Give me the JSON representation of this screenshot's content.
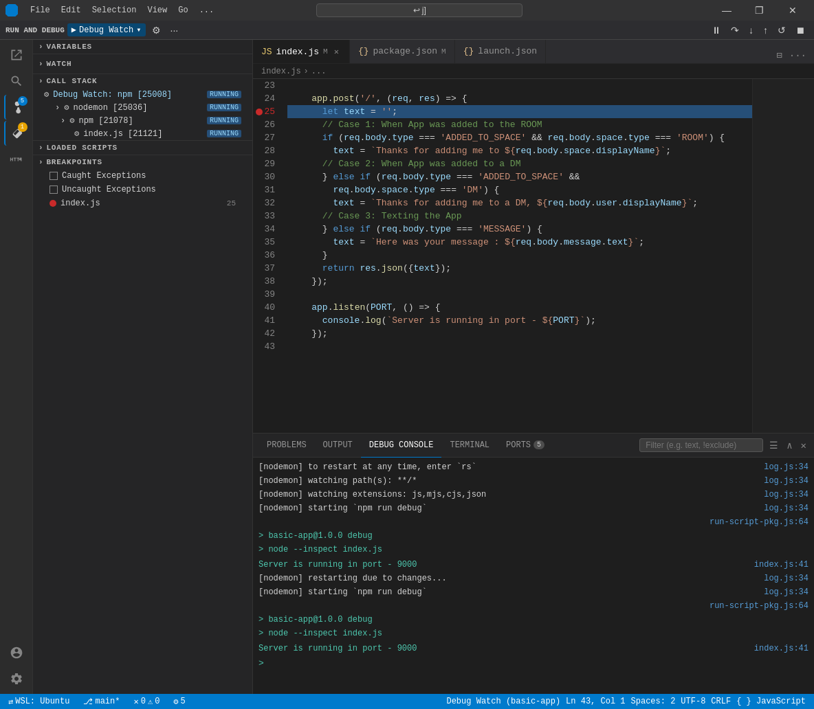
{
  "titlebar": {
    "menu_items": [
      "File",
      "Edit",
      "Selection",
      "View",
      "Go",
      "..."
    ],
    "search_placeholder": "",
    "controls": [
      "—",
      "❐",
      "✕"
    ]
  },
  "debug_toolbar": {
    "label": "RUN AND DEBUG",
    "dropdown_label": "Debug Watch",
    "buttons": [
      "▶",
      "⏸",
      "↻",
      "↓",
      "↑",
      "↺",
      "⏹"
    ]
  },
  "tabs": [
    {
      "label": "index.js",
      "modified": true,
      "active": true,
      "icon": "JS"
    },
    {
      "label": "package.json",
      "modified": true,
      "active": false,
      "icon": "{}"
    },
    {
      "label": "launch.json",
      "modified": false,
      "active": false,
      "icon": "{}"
    }
  ],
  "breadcrumb": "index.js > ...",
  "code_lines": [
    {
      "num": 23,
      "content": ""
    },
    {
      "num": 24,
      "content": "    app.post('/', (req, res) => {",
      "tokens": [
        {
          "t": "fn",
          "v": "app.post"
        },
        {
          "t": "punct",
          "v": "("
        },
        {
          "t": "str",
          "v": "'/'"
        },
        {
          "t": "punct",
          "v": ", ("
        },
        {
          "t": "param",
          "v": "req"
        },
        {
          "t": "punct",
          "v": ", "
        },
        {
          "t": "param",
          "v": "res"
        },
        {
          "t": "punct",
          "v": ") => {"
        }
      ]
    },
    {
      "num": 25,
      "content": "      let text = '';",
      "breakpoint": true
    },
    {
      "num": 26,
      "content": "      // Case 1: When App was added to the ROOM",
      "comment": true
    },
    {
      "num": 27,
      "content": "      if (req.body.type === 'ADDED_TO_SPACE' && req.body.space.type === 'ROOM') {"
    },
    {
      "num": 28,
      "content": "        text = `Thanks for adding me to ${req.body.space.displayName}`;"
    },
    {
      "num": 29,
      "content": "      // Case 2: When App was added to a DM",
      "comment": true
    },
    {
      "num": 30,
      "content": "      } else if (req.body.type === 'ADDED_TO_SPACE' &&"
    },
    {
      "num": 31,
      "content": "        req.body.space.type === 'DM') {"
    },
    {
      "num": 32,
      "content": "        text = `Thanks for adding me to a DM, ${req.body.user.displayName}`;"
    },
    {
      "num": 33,
      "content": "      // Case 3: Texting the App",
      "comment": true
    },
    {
      "num": 34,
      "content": "      } else if (req.body.type === 'MESSAGE') {"
    },
    {
      "num": 35,
      "content": "        text = `Here was your message : ${req.body.message.text}`;"
    },
    {
      "num": 36,
      "content": "      }"
    },
    {
      "num": 37,
      "content": "      return res.json({text});"
    },
    {
      "num": 38,
      "content": "    });"
    },
    {
      "num": 39,
      "content": ""
    },
    {
      "num": 40,
      "content": "    app.listen(PORT, () => {"
    },
    {
      "num": 41,
      "content": "      console.log(`Server is running in port - ${PORT}`);"
    },
    {
      "num": 42,
      "content": "    });"
    },
    {
      "num": 43,
      "content": ""
    }
  ],
  "sidebar": {
    "sections": {
      "variables": "VARIABLES",
      "watch": "WATCH",
      "call_stack": "CALL STACK",
      "loaded_scripts": "LOADED SCRIPTS",
      "breakpoints": "BREAKPOINTS"
    },
    "call_stack_items": [
      {
        "label": "Debug Watch: npm [25008]",
        "status": "RUNNING",
        "indent": 0,
        "icon": "gear"
      },
      {
        "label": "nodemon [25036]",
        "status": "RUNNING",
        "indent": 1,
        "icon": "gear"
      },
      {
        "label": "npm [21078]",
        "status": "RUNNING",
        "indent": 2,
        "icon": "gear"
      },
      {
        "label": "index.js [21121]",
        "status": "RUNNING",
        "indent": 3,
        "icon": "gear"
      }
    ],
    "breakpoints": [
      {
        "label": "Caught Exceptions",
        "type": "checkbox",
        "checked": false
      },
      {
        "label": "Uncaught Exceptions",
        "type": "checkbox",
        "checked": false
      },
      {
        "label": "index.js",
        "type": "dot",
        "line": 25
      }
    ]
  },
  "panel": {
    "tabs": [
      {
        "label": "PROBLEMS",
        "active": false
      },
      {
        "label": "OUTPUT",
        "active": false
      },
      {
        "label": "DEBUG CONSOLE",
        "active": true
      },
      {
        "label": "TERMINAL",
        "active": false
      },
      {
        "label": "PORTS",
        "active": false,
        "badge": "5"
      }
    ],
    "filter_placeholder": "Filter (e.g. text, !exclude)",
    "console_lines": [
      {
        "text": "[nodemon] to restart at any time, enter `rs`",
        "source": "log.js:34"
      },
      {
        "text": "[nodemon] watching path(s): **/*",
        "source": "log.js:34"
      },
      {
        "text": "[nodemon] watching extensions: js,mjs,cjs,json",
        "source": "log.js:34"
      },
      {
        "text": "[nodemon] starting `npm run debug`",
        "source": "log.js:34"
      },
      {
        "text": "",
        "source": "run-script-pkg.js:64"
      },
      {
        "text": "> basic-app@1.0.0 debug",
        "source": "",
        "green": true
      },
      {
        "text": "> node --inspect index.js",
        "source": "",
        "green": true
      },
      {
        "text": "",
        "source": ""
      },
      {
        "text": "Server is running in port - 9000",
        "source": "index.js:41",
        "green": true
      },
      {
        "text": "[nodemon] restarting due to changes...",
        "source": "log.js:34"
      },
      {
        "text": "[nodemon] starting `npm run debug`",
        "source": "log.js:34"
      },
      {
        "text": "",
        "source": "run-script-pkg.js:64"
      },
      {
        "text": "> basic-app@1.0.0 debug",
        "source": "",
        "green": true
      },
      {
        "text": "> node --inspect index.js",
        "source": "",
        "green": true
      },
      {
        "text": "",
        "source": ""
      },
      {
        "text": "Server is running in port - 9000",
        "source": "index.js:41",
        "green": true
      }
    ]
  },
  "status_bar": {
    "left_items": [
      {
        "icon": "branch",
        "label": "WSL: Ubuntu"
      },
      {
        "icon": "git",
        "label": "main*"
      },
      {
        "icon": "error",
        "label": "0"
      },
      {
        "icon": "warn",
        "label": "0"
      },
      {
        "icon": "debug",
        "label": "5"
      }
    ],
    "right_items": [
      {
        "label": "Debug Watch (basic-app)"
      },
      {
        "label": "Ln 43, Col 1"
      },
      {
        "label": "Spaces: 2"
      },
      {
        "label": "UTF-8"
      },
      {
        "label": "CRLF"
      },
      {
        "label": "{ } JavaScript"
      }
    ]
  }
}
